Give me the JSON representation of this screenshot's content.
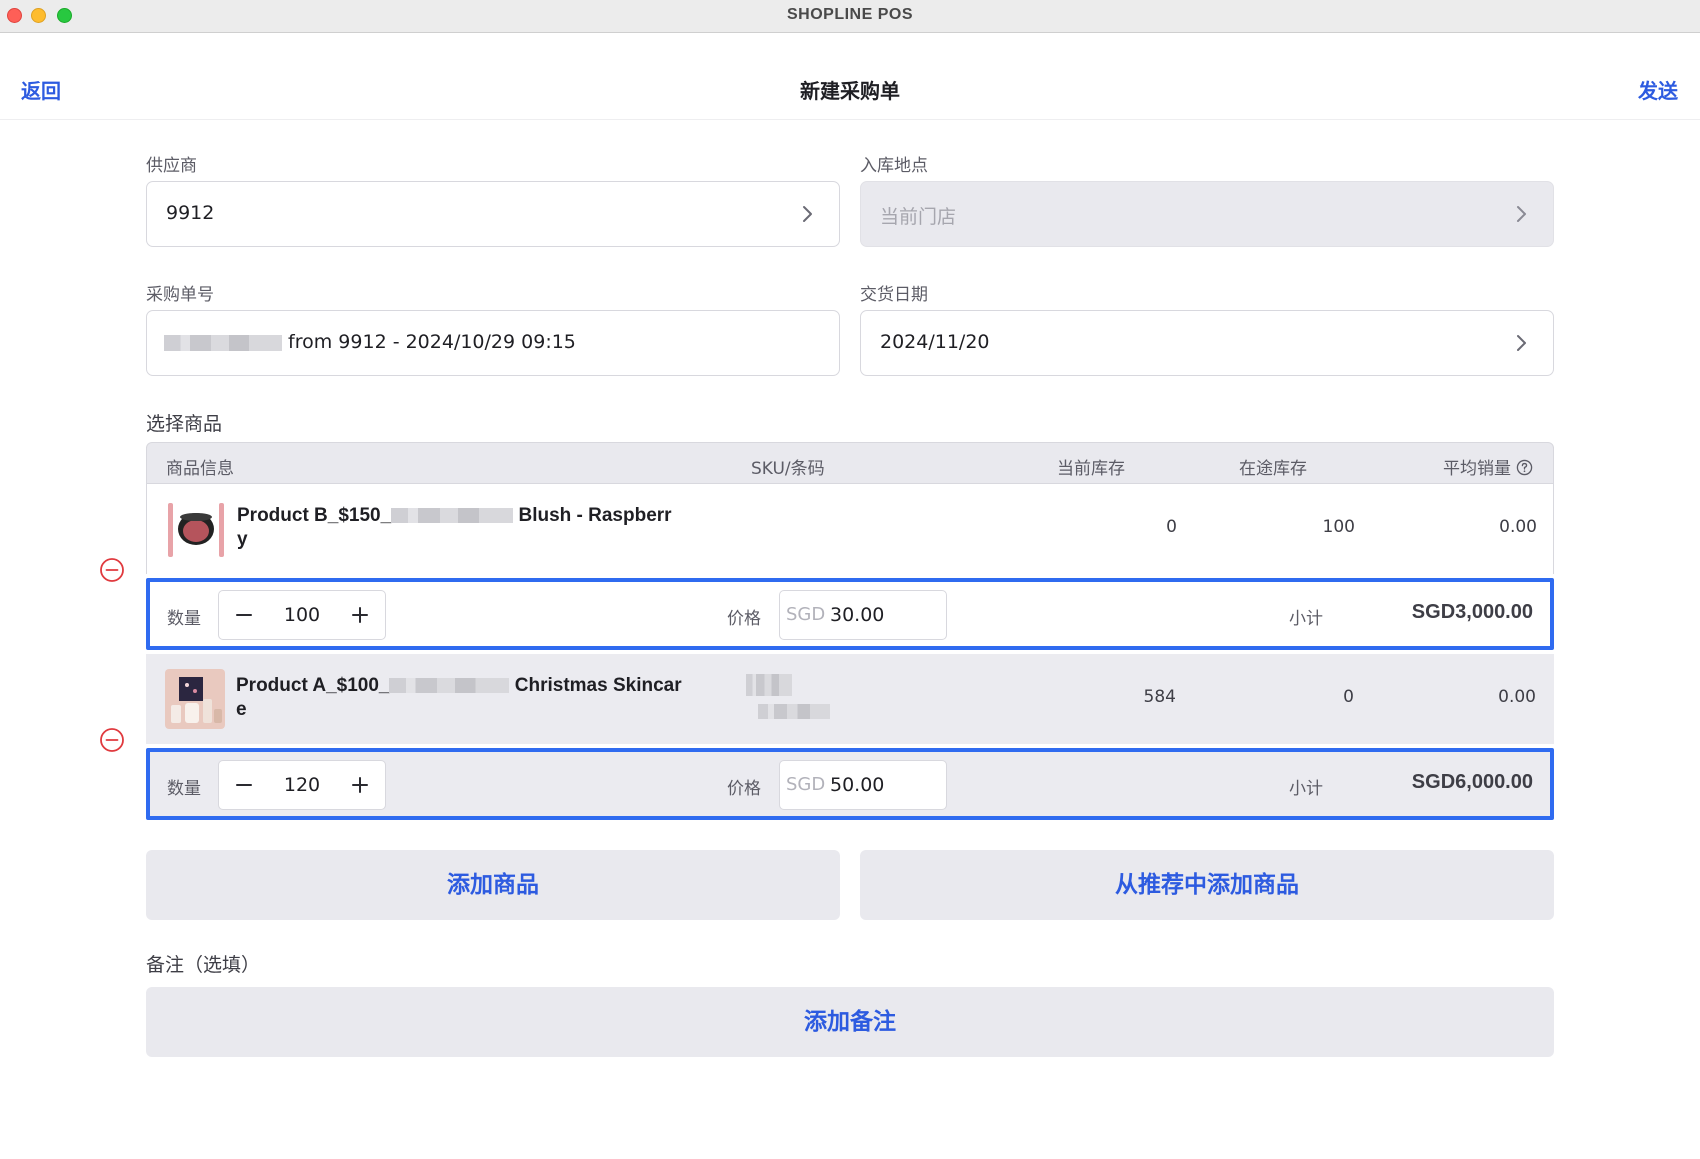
{
  "window": {
    "title": "SHOPLINE POS"
  },
  "nav": {
    "back": "返回",
    "title": "新建采购单",
    "send": "发送"
  },
  "form": {
    "supplier": {
      "label": "供应商",
      "value": "9912"
    },
    "location": {
      "label": "入库地点",
      "value": "当前门店"
    },
    "po_number": {
      "label": "采购单号",
      "value": "from 9912 - 2024/10/29 09:15"
    },
    "delivery_date": {
      "label": "交货日期",
      "value": "2024/11/20"
    }
  },
  "products_section": {
    "label": "选择商品",
    "columns": [
      "商品信息",
      "SKU/条码",
      "当前库存",
      "在途库存",
      "平均销量"
    ],
    "qty_label": "数量",
    "price_label": "价格",
    "subtotal_label": "小计",
    "currency": "SGD",
    "items": [
      {
        "name_prefix": "Product B_$150_",
        "name_suffix": "Blush - Raspberr",
        "name_wrap": "y",
        "stock": "0",
        "in_transit": "100",
        "avg_sales": "0.00",
        "quantity": "100",
        "price": "30.00",
        "subtotal": "SGD3,000.00"
      },
      {
        "name_prefix": "Product A_$100_",
        "name_suffix": "Christmas Skincar",
        "name_wrap": "e",
        "stock": "584",
        "in_transit": "0",
        "avg_sales": "0.00",
        "quantity": "120",
        "price": "50.00",
        "subtotal": "SGD6,000.00"
      }
    ]
  },
  "actions": {
    "add_product": "添加商品",
    "add_recommended": "从推荐中添加商品"
  },
  "notes": {
    "label": "备注（选填）",
    "add_note": "添加备注"
  },
  "colors": {
    "accent": "#2d5be0",
    "highlight_border": "#2f6bf0",
    "remove": "#e0393e"
  }
}
